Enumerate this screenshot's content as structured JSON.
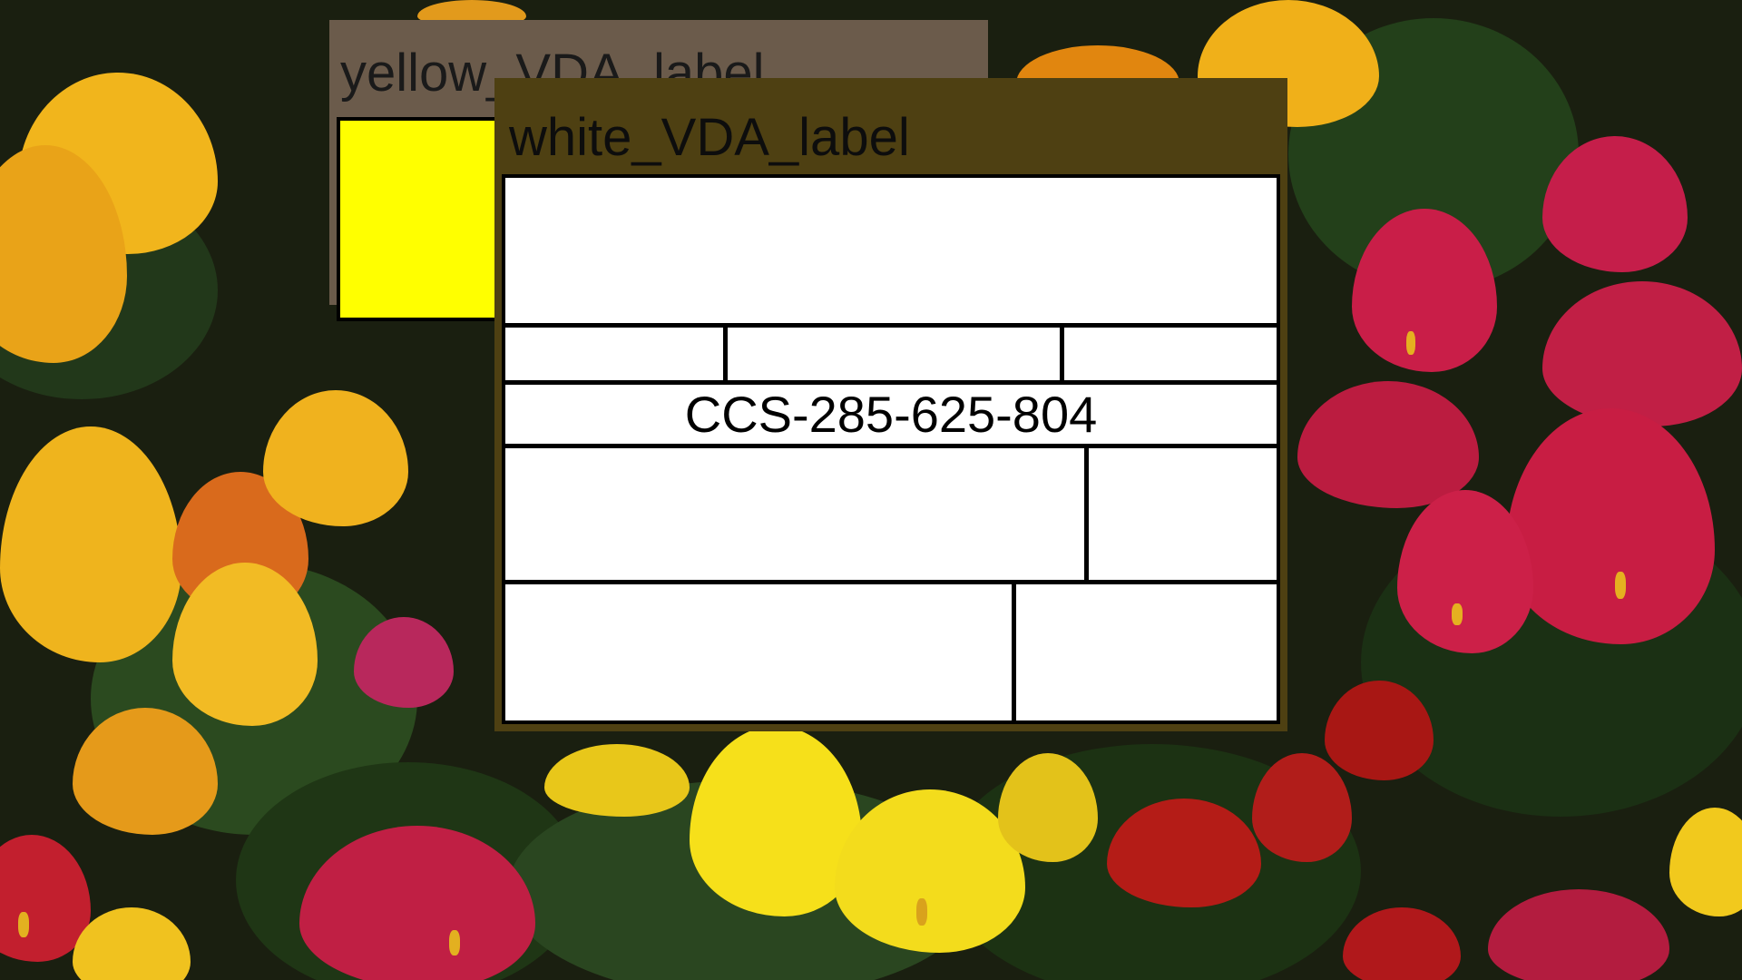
{
  "desktop": {
    "wallpaper": "calla-lily-flowers",
    "colors": {
      "leaf": "#2e4a1c",
      "leaf_dark": "#1c2e12",
      "yellow_flower": "#f3c21a",
      "orange_flower": "#e8a11c",
      "red_flower": "#c2203a",
      "crimson_flower": "#b0162e"
    }
  },
  "windows": {
    "yellow": {
      "title": "yellow_VDA_label",
      "label_color": "#ffff00",
      "frame_color": "#6b5b4b"
    },
    "white": {
      "title": "white_VDA_label",
      "label_color": "#ffffff",
      "frame_color": "#4e4012",
      "code": "CCS-285-625-804"
    }
  }
}
